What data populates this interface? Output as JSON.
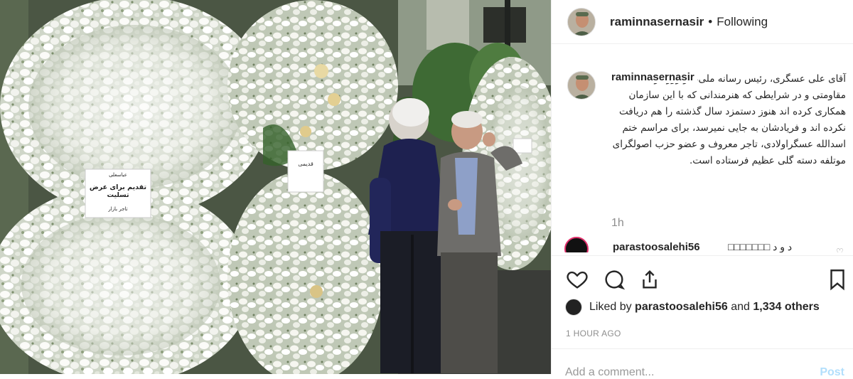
{
  "post": {
    "username": "raminnasernasir",
    "separator": "•",
    "follow_status": "Following",
    "photo_alt": "Funeral flower wreaths with two men talking",
    "wreath_card_left": "تقدیم برای عرض تسلیت",
    "wreath_card_left_small": "عباسعلی",
    "wreath_card_left_footer": "تاجر بازار",
    "wreath_card_mid": "قدیمی"
  },
  "caption": {
    "username": "raminnasernasir",
    "text": "آقای علی عسگری، رئیس رسانه ملی، در روزگار اقتصاد مقاومتی و در شرایطی که هنرمندانی که با این سازمان همکاری کرده اند هنوز دستمزد سال گذشته را هم دریافت نکرده اند و فریادشان به جایی نمیرسد، برای مراسم ختم اسدالله عسگراولادی، تاجر معروف و عضو حزب اصولگرای موتلفه دسته گلی عظیم فرستاده است.",
    "time": "1h"
  },
  "comment": {
    "username": "parastoosalehi56",
    "text": "□□□□□□□ د و د"
  },
  "actions": {
    "like_icon": "heart-icon",
    "comment_icon": "comment-icon",
    "share_icon": "share-icon",
    "save_icon": "bookmark-icon"
  },
  "likes": {
    "prefix": "Liked by ",
    "user": "parastoosalehi56",
    "middle": " and ",
    "count": "1,334 others"
  },
  "timestamp": "1 HOUR AGO",
  "add_comment": {
    "placeholder": "Add a comment...",
    "post_label": "Post"
  }
}
